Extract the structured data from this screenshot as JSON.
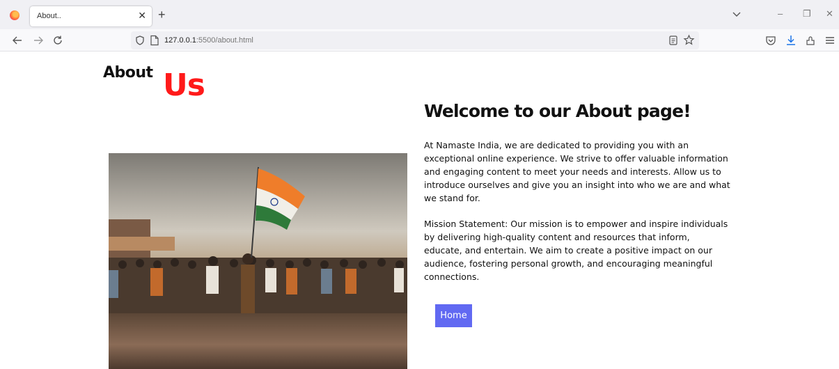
{
  "browser": {
    "tab_title": "About..",
    "tab_close": "✕",
    "new_tab": "+",
    "url_host": "127.0.0.1",
    "url_path": ":5500/about.html",
    "window_minimize": "–",
    "window_restore": "❐",
    "window_close": "✕",
    "icons": [
      "firefox-logo",
      "back-icon",
      "forward-icon",
      "reload-icon",
      "shield-icon",
      "page-icon",
      "reader-icon",
      "bookmark-star-icon",
      "pocket-icon",
      "download-icon",
      "extensions-icon",
      "menu-icon",
      "list-all-tabs-icon"
    ]
  },
  "page": {
    "heading_about": "About",
    "heading_us": "Us",
    "welcome_title": "Welcome to our About page!",
    "paragraph_1": "At Namaste India, we are dedicated to providing you with an exceptional online experience. We strive to offer valuable information and engaging content to meet your needs and interests. Allow us to introduce ourselves and give you an insight into who we are and what we stand for.",
    "paragraph_2": "Mission Statement: Our mission is to empower and inspire individuals by delivering high-quality content and resources that inform, educate, and entertain. We aim to create a positive impact on our audience, fostering personal growth, and encouraging meaningful connections.",
    "home_button": "Home",
    "accent_color": "#ff1a1a",
    "button_color": "#6169f2"
  }
}
